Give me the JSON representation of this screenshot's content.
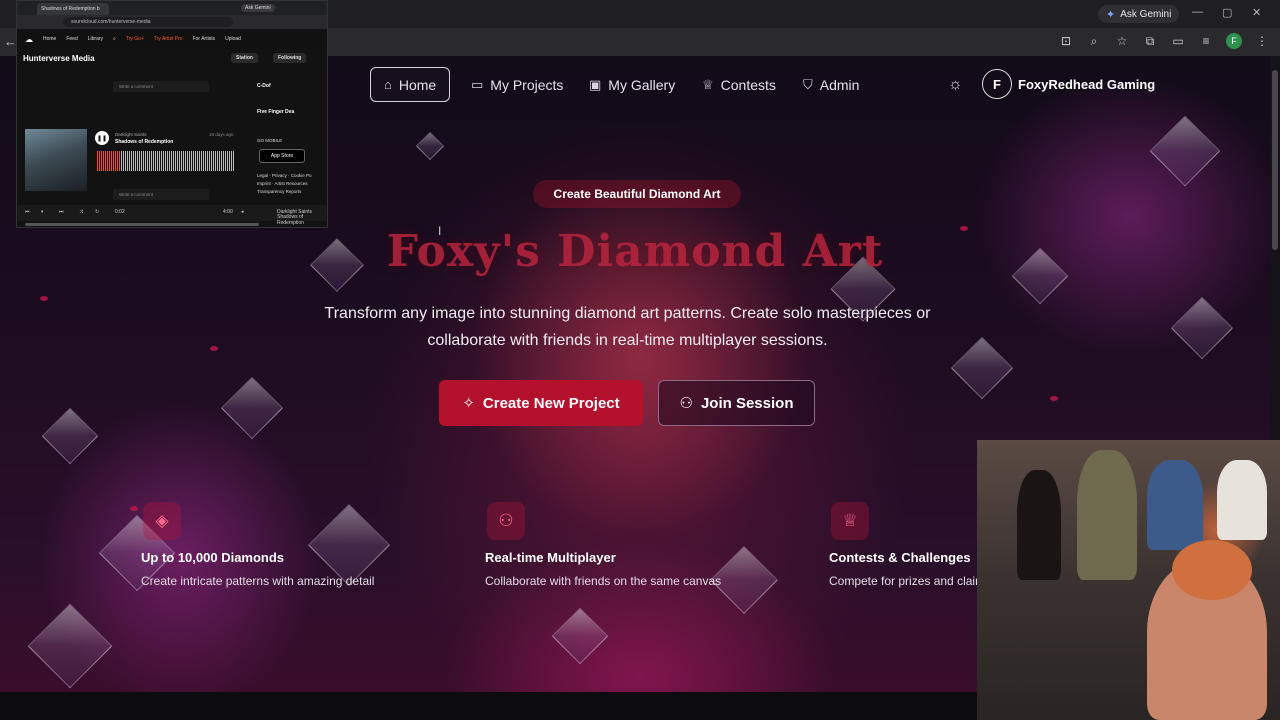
{
  "browser": {
    "ask_gemini": "Ask Gemini"
  },
  "nav": {
    "items": [
      {
        "label": "Home",
        "icon": "home-icon"
      },
      {
        "label": "My Projects",
        "icon": "folder-icon"
      },
      {
        "label": "My Gallery",
        "icon": "image-icon"
      },
      {
        "label": "Contests",
        "icon": "trophy-icon"
      },
      {
        "label": "Admin",
        "icon": "shield-icon"
      }
    ],
    "avatar_letter": "F",
    "user_name": "FoxyRedhead Gaming"
  },
  "hero": {
    "badge": "Create Beautiful Diamond Art",
    "title": "Foxy's Diamond Art",
    "subtitle_line1": "Transform any image into stunning diamond art patterns. Create solo masterpieces or",
    "subtitle_line2": "collaborate with friends in real-time multiplayer sessions.",
    "primary_button": "Create New Project",
    "secondary_button": "Join Session"
  },
  "features": [
    {
      "title": "Up to 10,000 Diamonds",
      "desc": "Create intricate patterns with amazing detail",
      "icon": "gem-icon"
    },
    {
      "title": "Real-time Multiplayer",
      "desc": "Collaborate with friends on the same canvas",
      "icon": "users-icon"
    },
    {
      "title": "Contests & Challenges",
      "desc": "Compete for prizes and clain",
      "icon": "trophy-icon"
    }
  ],
  "soundcloud": {
    "tab_title": "Shadows of Redemption b",
    "url": "soundcloud.com/hunterverse-media",
    "ask_gemini": "Ask Gemini",
    "nav": [
      "Home",
      "Feed",
      "Library",
      "Try Go+",
      "Try Artist Pro",
      "For Artists",
      "Upload"
    ],
    "profile_name": "Hunterverse Media",
    "station": "Station",
    "following": "Following",
    "comment_placeholder": "Write a comment",
    "artist": "Darklight Saints",
    "track": "Shadows of Redemption",
    "time_ago": "18 days ago",
    "side_1": "C-Dof",
    "side_2": "Five Finger Dea",
    "go_mobile": "GO MOBILE",
    "app_store": "App Store",
    "footer": "Legal · Privacy · Cookie Po",
    "footer2": "Imprint · Artist Resources",
    "footer3": "Transparency Reports",
    "time_elapsed": "0:02",
    "time_total": "4:00",
    "player_artist": "Darklight Saints",
    "player_track": "Shadows of Redemption"
  },
  "colors": {
    "primary": "#b3112c",
    "title": "#b8243d",
    "accent_icon": "#ff6b8a"
  }
}
